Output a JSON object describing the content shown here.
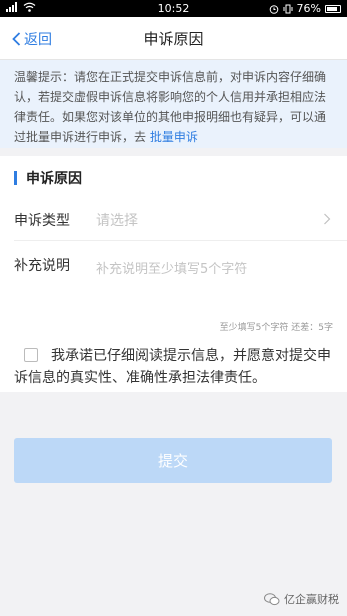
{
  "status_bar": {
    "time": "10:52",
    "battery": "76%"
  },
  "nav": {
    "back_label": "返回",
    "title": "申诉原因"
  },
  "notice": {
    "text": "温馨提示：请您在正式提交申诉信息前，对申诉内容仔细确认，若提交虚假申诉信息将影响您的个人信用并承担相应法律责任。如果您对该单位的其他申报明细也有疑异，可以通过批量申诉进行申诉，去",
    "link": "批量申诉"
  },
  "section": {
    "title": "申诉原因"
  },
  "fields": {
    "type_label": "申诉类型",
    "type_placeholder": "请选择",
    "note_label": "补充说明",
    "note_placeholder": "补充说明至少填写5个字符"
  },
  "counter": "至少填写5个字符 还差：5字",
  "agreement": "我承诺已仔细阅读提示信息，并愿意对提交申诉信息的真实性、准确性承担法律责任。",
  "submit_label": "提交",
  "watermark": "亿企赢财税",
  "colors": {
    "accent": "#2f7de1",
    "submit_disabled": "#bcd8f7",
    "notice_bg": "#eaf2fc"
  }
}
